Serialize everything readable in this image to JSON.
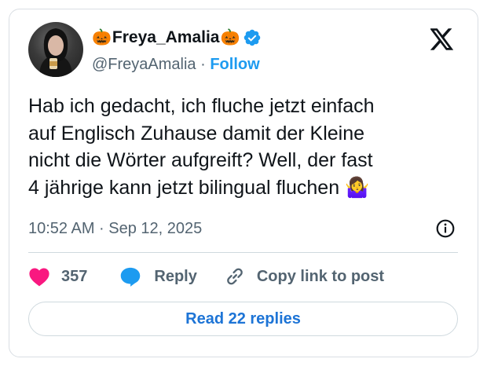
{
  "author": {
    "display_name": "Freya_Amalia",
    "name_prefix_emoji": "🎃",
    "name_suffix_emoji": "🎃",
    "handle": "@FreyaAmalia",
    "separator": " · ",
    "follow_label": "Follow",
    "verified_icon": "verified-badge-icon",
    "verified_color": "#1d9bf0"
  },
  "platform_icon": "x-logo-icon",
  "tweet": {
    "text": "Hab ich gedacht, ich fluche jetzt einfach\nauf Englisch Zuhause damit der Kleine\nnicht die Wörter aufgreift? Well, der fast\n4 jährige kann jetzt bilingual fluchen 🤷‍♀️",
    "timestamp": "10:52 AM · Sep 12, 2025"
  },
  "actions": {
    "like_count": "357",
    "reply_label": "Reply",
    "copy_label": "Copy link to post"
  },
  "read_replies_label": "Read 22 replies",
  "colors": {
    "accent": "#1d9bf0",
    "like": "#f91880",
    "text": "#0f1419",
    "muted": "#536471"
  }
}
